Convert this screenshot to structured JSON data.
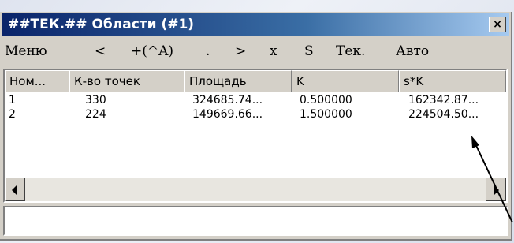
{
  "window": {
    "title": "##ТЕК.## Области (#1)",
    "close_glyph": "×"
  },
  "menu": [
    "Меню",
    "<",
    "+(^A)",
    ".",
    ">",
    "x",
    "S",
    "Тек.",
    "Авто"
  ],
  "table": {
    "columns": [
      "Ном...",
      "К-во точек",
      "Площадь",
      "K",
      "s*K"
    ],
    "rows": [
      [
        "1",
        "330",
        "324685.74...",
        "0.500000",
        "162342.87..."
      ],
      [
        "2",
        "224",
        "149669.66...",
        "1.500000",
        "224504.50..."
      ]
    ]
  },
  "status": {
    "text": ""
  },
  "colors": {
    "title_bar_start": "#0a246a",
    "title_bar_end": "#a6caf0",
    "window_face": "#d4d0c8"
  },
  "icons": {
    "scroll_left": "scroll-left-arrow-icon",
    "scroll_right": "scroll-right-arrow-icon",
    "close": "close-icon",
    "annotation": "pointer-arrow-icon"
  }
}
